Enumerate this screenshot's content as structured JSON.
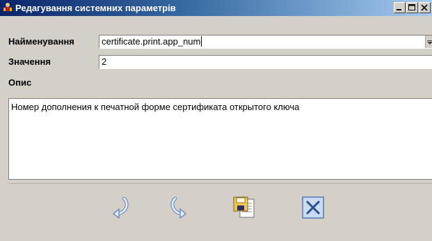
{
  "window": {
    "title": "Редагування системних параметрів",
    "icon": "app-figure-icon"
  },
  "form": {
    "name_label": "Найменування",
    "name_value": "certificate.print.app_num",
    "value_label": "Значення",
    "value_value": "2",
    "description_label": "Опис",
    "description_value": "Номер дополнения к печатной форме сертификата открытого ключа"
  },
  "toolbar": {
    "buttons": [
      {
        "icon": "undo-arrow-icon"
      },
      {
        "icon": "redo-arrow-icon"
      },
      {
        "icon": "save-document-icon"
      },
      {
        "icon": "close-x-icon"
      }
    ]
  },
  "colors": {
    "titlebar_start": "#0a246a",
    "titlebar_end": "#a6caf0",
    "window_bg": "#d4d0c8"
  }
}
